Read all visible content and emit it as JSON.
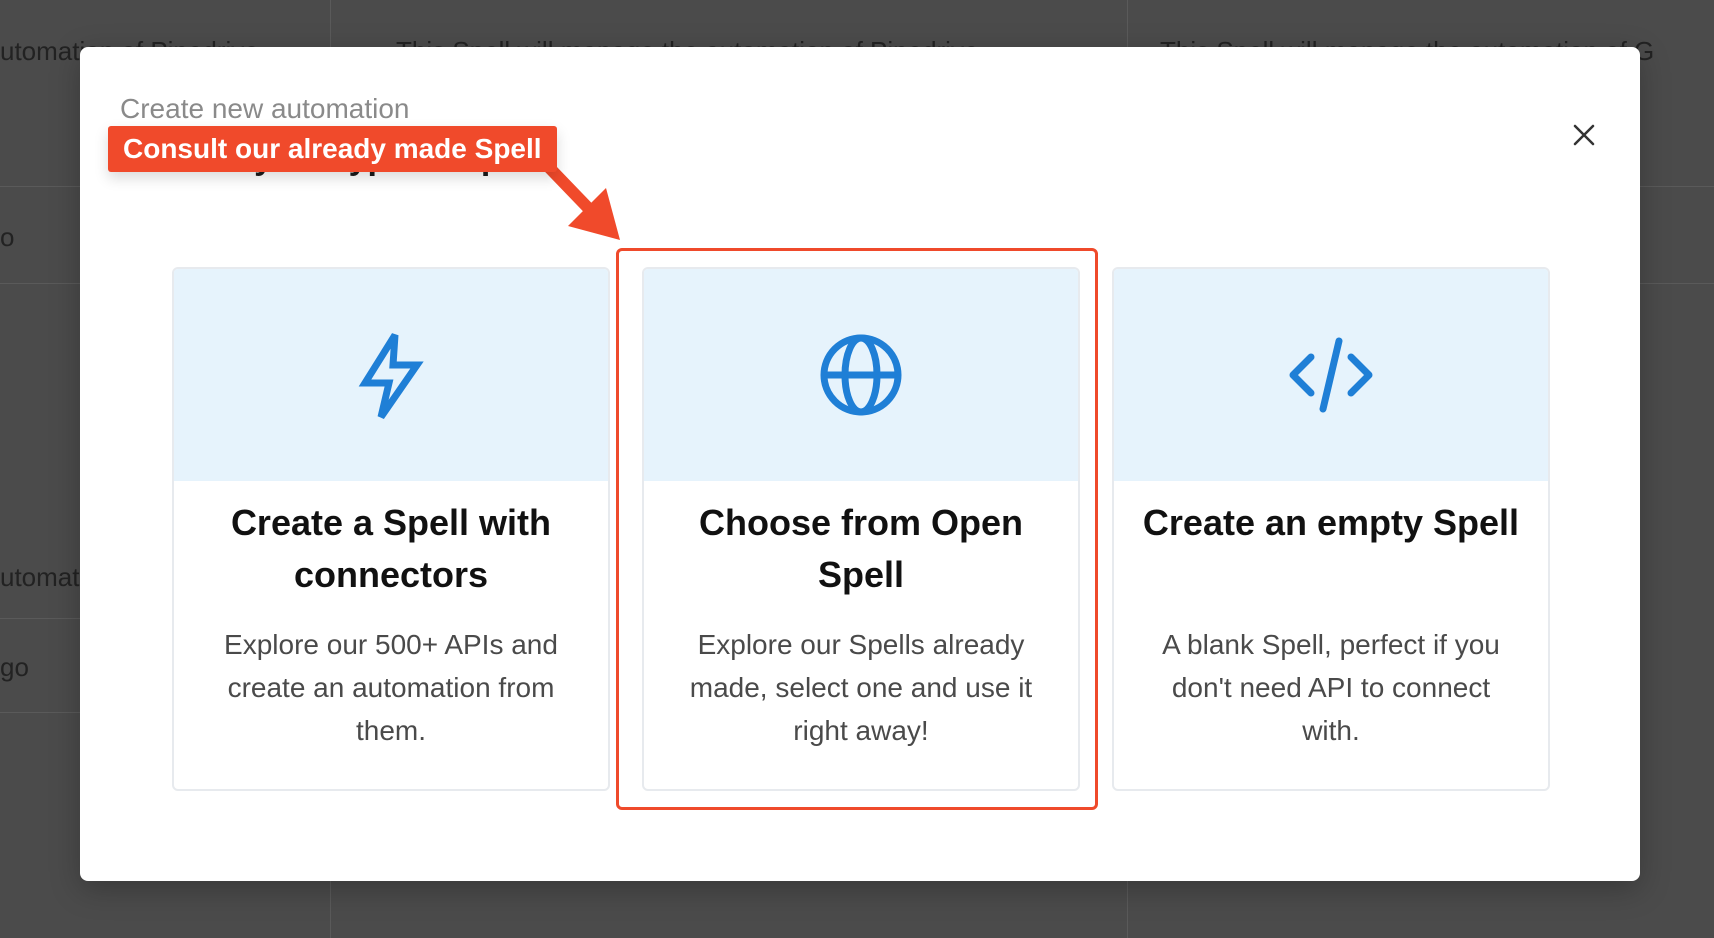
{
  "background": {
    "snippets": [
      "utomation of Pipedrive",
      "This Spell will manage the automation of Pipedrive",
      "This Spell will manage the automation of G",
      "o",
      "utomat",
      "go"
    ]
  },
  "modal": {
    "subtitle": "Create new automation",
    "title": "Choose your type of Spell",
    "close_icon": "close-icon",
    "cards": [
      {
        "icon": "lightning-icon",
        "title": "Create a Spell with connectors",
        "description": "Explore our 500+ APIs and create an automation from them."
      },
      {
        "icon": "globe-icon",
        "title": "Choose from Open Spell",
        "description": "Explore our Spells already made, select one and use it right away!"
      },
      {
        "icon": "code-icon",
        "title": "Create an empty Spell",
        "description": "A blank Spell, perfect if you don't need API to connect with."
      }
    ]
  },
  "annotation": {
    "callout": "Consult our already made Spell",
    "color": "#f04a2b"
  },
  "colors": {
    "accent": "#1f7fd6",
    "banner": "#e6f3fc"
  }
}
